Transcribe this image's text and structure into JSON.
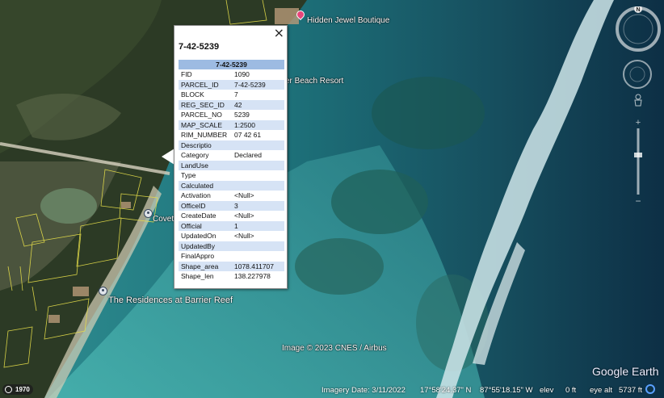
{
  "map": {
    "labels": {
      "jewel_boutique": "Hidden Jewel Boutique",
      "beach_resort": "er Beach Resort",
      "covet": "Covet",
      "residences": "The Residences at Barrier Reef"
    },
    "copyright": "Image © 2023 CNES / Airbus"
  },
  "popup": {
    "title": "7-42-5239",
    "table_header": "7-42-5239",
    "close": "×",
    "rows": [
      {
        "key": "FID",
        "value": "1090"
      },
      {
        "key": "PARCEL_ID",
        "value": "7-42-5239"
      },
      {
        "key": "BLOCK",
        "value": "7"
      },
      {
        "key": "REG_SEC_ID",
        "value": "42"
      },
      {
        "key": "PARCEL_NO",
        "value": "5239"
      },
      {
        "key": "MAP_SCALE",
        "value": "1:2500"
      },
      {
        "key": "RIM_NUMBER",
        "value": "07 42 61"
      },
      {
        "key": "Descriptio",
        "value": ""
      },
      {
        "key": "Category",
        "value": "Declared"
      },
      {
        "key": "LandUse",
        "value": ""
      },
      {
        "key": "Type",
        "value": ""
      },
      {
        "key": "Calculated",
        "value": ""
      },
      {
        "key": "Activation",
        "value": "<Null>"
      },
      {
        "key": "OfficeID",
        "value": "3"
      },
      {
        "key": "CreateDate",
        "value": "<Null>"
      },
      {
        "key": "Official",
        "value": "1"
      },
      {
        "key": "UpdatedOn",
        "value": "<Null>"
      },
      {
        "key": "UpdatedBy",
        "value": ""
      },
      {
        "key": "FinalAppro",
        "value": ""
      },
      {
        "key": "Shape_area",
        "value": "1078.411707"
      },
      {
        "key": "Shape_len",
        "value": "138.227978"
      }
    ]
  },
  "nav": {
    "compass_north": "N",
    "compass_icon": "compass-icon",
    "look_icon": "look-joystick-icon",
    "pegman_icon": "pegman-icon",
    "zoom_icon": "zoom-slider-icon"
  },
  "status_bar": {
    "year": "1970",
    "imagery_date": "Imagery Date: 3/11/2022",
    "lat": "17°58'24.37\" N",
    "lon": "87°55'18.15\" W",
    "elev_label": "elev",
    "elev_value": "0 ft",
    "eye_alt_label": "eye alt",
    "eye_alt_value": "5737 ft"
  },
  "branding": {
    "logo": "Google Earth"
  },
  "colors": {
    "table_header": "#9dbbe2",
    "row_alt": "#d6e3f5",
    "parcel_lines": "#e8e04a",
    "shop_pin": "#e8457a"
  }
}
